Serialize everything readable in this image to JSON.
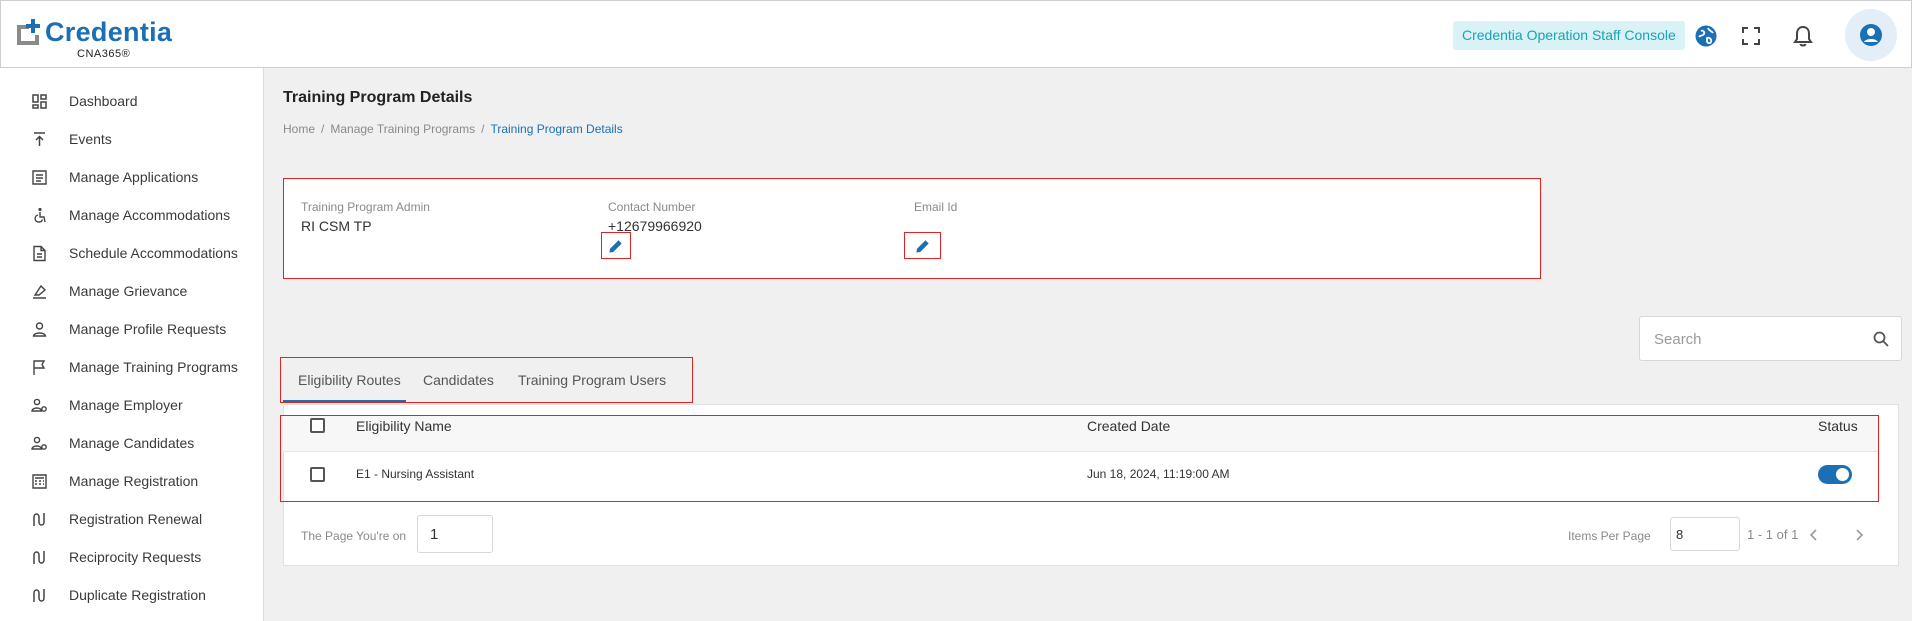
{
  "header": {
    "logo_text": "Credentia",
    "logo_sub": "CNA365®",
    "console_label": "Credentia Operation Staff Console",
    "icons": [
      "globe-icon",
      "fullscreen-icon",
      "bell-icon",
      "user-avatar-icon"
    ]
  },
  "sidebar": {
    "items": [
      {
        "label": "Dashboard",
        "icon": "dashboard-icon"
      },
      {
        "label": "Events",
        "icon": "events-icon"
      },
      {
        "label": "Manage Applications",
        "icon": "applications-icon"
      },
      {
        "label": "Manage Accommodations",
        "icon": "accessibility-icon"
      },
      {
        "label": "Schedule Accommodations",
        "icon": "document-icon"
      },
      {
        "label": "Manage Grievance",
        "icon": "grievance-icon"
      },
      {
        "label": "Manage Profile Requests",
        "icon": "profile-icon"
      },
      {
        "label": "Manage Training Programs",
        "icon": "flag-icon"
      },
      {
        "label": "Manage Employer",
        "icon": "employer-icon"
      },
      {
        "label": "Manage Candidates",
        "icon": "candidates-icon"
      },
      {
        "label": "Manage Registration",
        "icon": "registration-icon"
      },
      {
        "label": "Registration Renewal",
        "icon": "route-icon"
      },
      {
        "label": "Reciprocity Requests",
        "icon": "route-icon"
      },
      {
        "label": "Duplicate Registration",
        "icon": "route-icon"
      }
    ]
  },
  "page": {
    "title": "Training Program Details",
    "breadcrumb": [
      "Home",
      "Manage Training Programs",
      "Training Program Details"
    ]
  },
  "info": {
    "admin_label": "Training Program Admin",
    "admin_value": "RI CSM TP",
    "contact_label": "Contact Number",
    "contact_value": "+12679966920",
    "email_label": "Email Id",
    "email_value": ""
  },
  "search": {
    "placeholder": "Search",
    "value": ""
  },
  "tabs": [
    {
      "label": "Eligibility Routes",
      "active": true
    },
    {
      "label": "Candidates",
      "active": false
    },
    {
      "label": "Training Program Users",
      "active": false
    }
  ],
  "table": {
    "columns": [
      "Eligibility Name",
      "Created Date",
      "Status"
    ],
    "rows": [
      {
        "name": "E1 - Nursing Assistant",
        "created": "Jun 18, 2024, 11:19:00 AM",
        "status": true
      }
    ]
  },
  "pagination": {
    "page_label": "The Page You're on",
    "page_value": "1",
    "items_label": "Items Per Page",
    "items_value": "8",
    "range": "1 - 1 of 1"
  },
  "colors": {
    "brand": "#1b6fb5",
    "console_badge_bg": "#d9f2f5",
    "console_badge_text": "#1aa3b3",
    "highlight": "#e02424"
  }
}
